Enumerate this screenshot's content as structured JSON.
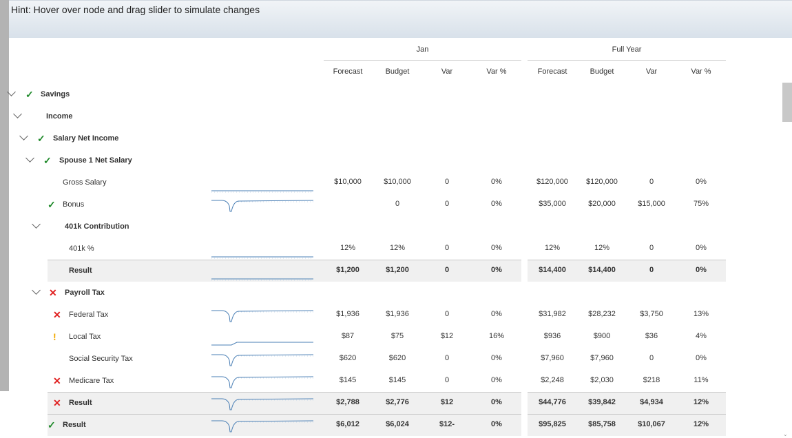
{
  "hint": "Hint: Hover over node and drag slider to simulate changes",
  "groups": {
    "jan": "Jan",
    "full_year": "Full Year"
  },
  "columns": [
    "Forecast",
    "Budget",
    "Var",
    "Var %",
    "Forecast",
    "Budget",
    "Var",
    "Var %"
  ],
  "rows": [
    {
      "label": "Savings",
      "bold": true,
      "status": "check",
      "values": []
    },
    {
      "label": "Income",
      "bold": true,
      "status": "",
      "values": []
    },
    {
      "label": "Salary Net Income",
      "bold": true,
      "status": "check",
      "values": []
    },
    {
      "label": "Spouse 1 Net Salary",
      "bold": true,
      "status": "check",
      "values": []
    },
    {
      "label": "Gross Salary",
      "bold": false,
      "status": "",
      "values": [
        "$10,000",
        "$10,000",
        "0",
        "0%",
        "$120,000",
        "$120,000",
        "0",
        "0%"
      ]
    },
    {
      "label": "Bonus",
      "bold": false,
      "status": "check",
      "values": [
        "",
        "0",
        "0",
        "0%",
        "$35,000",
        "$20,000",
        "$15,000",
        "75%"
      ]
    },
    {
      "label": "401k Contribution",
      "bold": true,
      "status": "",
      "values": []
    },
    {
      "label": "401k %",
      "bold": false,
      "status": "",
      "values": [
        "12%",
        "12%",
        "0",
        "0%",
        "12%",
        "12%",
        "0",
        "0%"
      ]
    },
    {
      "label": "Result",
      "bold": true,
      "status": "",
      "values": [
        "$1,200",
        "$1,200",
        "0",
        "0%",
        "$14,400",
        "$14,400",
        "0",
        "0%"
      ]
    },
    {
      "label": "Payroll Tax",
      "bold": true,
      "status": "cross",
      "values": []
    },
    {
      "label": "Federal Tax",
      "bold": false,
      "status": "cross",
      "values": [
        "$1,936",
        "$1,936",
        "0",
        "0%",
        "$31,982",
        "$28,232",
        "$3,750",
        "13%"
      ]
    },
    {
      "label": "Local Tax",
      "bold": false,
      "status": "warn",
      "values": [
        "$87",
        "$75",
        "$12",
        "16%",
        "$936",
        "$900",
        "$36",
        "4%"
      ]
    },
    {
      "label": "Social Security Tax",
      "bold": false,
      "status": "",
      "values": [
        "$620",
        "$620",
        "0",
        "0%",
        "$7,960",
        "$7,960",
        "0",
        "0%"
      ]
    },
    {
      "label": "Medicare Tax",
      "bold": false,
      "status": "cross",
      "values": [
        "$145",
        "$145",
        "0",
        "0%",
        "$2,248",
        "$2,030",
        "$218",
        "11%"
      ]
    },
    {
      "label": "Result",
      "bold": true,
      "status": "cross",
      "values": [
        "$2,788",
        "$2,776",
        "$12",
        "0%",
        "$44,776",
        "$39,842",
        "$4,934",
        "12%"
      ]
    },
    {
      "label": "Result",
      "bold": true,
      "status": "check",
      "values": [
        "$6,012",
        "$6,024",
        "$12-",
        "0%",
        "$95,825",
        "$85,758",
        "$10,067",
        "12%"
      ]
    }
  ],
  "icons": {
    "check": "check-icon",
    "cross": "cross-icon",
    "warn": "warning-icon",
    "expand": "chevron-down-icon"
  },
  "colors": {
    "check": "#1f8a2a",
    "cross": "#e02020",
    "warn": "#f2a900",
    "sparkline": "#4a7fb5"
  }
}
